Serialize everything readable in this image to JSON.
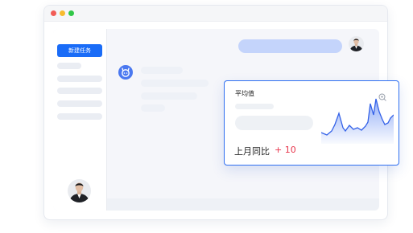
{
  "sidebar": {
    "new_task_label": "新建任务"
  },
  "card": {
    "title": "平均值",
    "compare_label": "上月同比",
    "compare_value": "+ 10"
  },
  "colors": {
    "accent": "#1a6cf7",
    "bubble": "#c4d4fb",
    "positive_change": "#e8344a",
    "window_dots": [
      "#f25c56",
      "#f7bb2e",
      "#31c748"
    ]
  },
  "icons": {
    "bot": "bot-icon",
    "zoom": "zoom-icon"
  }
}
